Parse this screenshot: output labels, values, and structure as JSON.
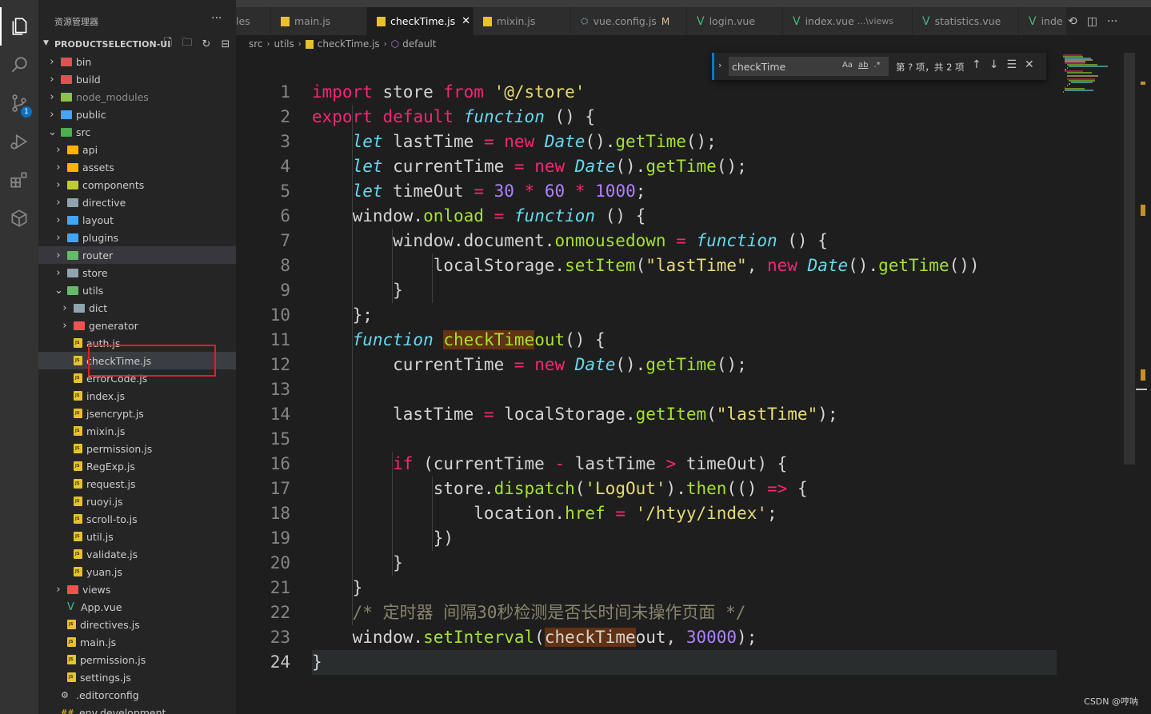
{
  "explorer": {
    "title": "资源管理器",
    "more": "···",
    "project": "PRODUCTSELECTION-UI"
  },
  "tree": [
    {
      "label": "bin",
      "depth": 0,
      "type": "folder",
      "expanded": false,
      "color": "#e05252"
    },
    {
      "label": "build",
      "depth": 0,
      "type": "folder",
      "expanded": false,
      "color": "#e05252"
    },
    {
      "label": "node_modules",
      "depth": 0,
      "type": "folder",
      "expanded": false,
      "color": "#8bc34a",
      "dim": true
    },
    {
      "label": "public",
      "depth": 0,
      "type": "folder",
      "expanded": false,
      "color": "#42a5f5"
    },
    {
      "label": "src",
      "depth": 0,
      "type": "folder",
      "expanded": true,
      "color": "#4caf50"
    },
    {
      "label": "api",
      "depth": 1,
      "type": "folder",
      "expanded": false,
      "color": "#ffb300"
    },
    {
      "label": "assets",
      "depth": 1,
      "type": "folder",
      "expanded": false,
      "color": "#ffb300"
    },
    {
      "label": "components",
      "depth": 1,
      "type": "folder",
      "expanded": false,
      "color": "#c0ca33"
    },
    {
      "label": "directive",
      "depth": 1,
      "type": "folder",
      "expanded": false,
      "color": "#90a4ae"
    },
    {
      "label": "layout",
      "depth": 1,
      "type": "folder",
      "expanded": false,
      "color": "#42a5f5"
    },
    {
      "label": "plugins",
      "depth": 1,
      "type": "folder",
      "expanded": false,
      "color": "#42a5f5"
    },
    {
      "label": "router",
      "depth": 1,
      "type": "folder",
      "expanded": false,
      "color": "#66bb6a",
      "hl": true
    },
    {
      "label": "store",
      "depth": 1,
      "type": "folder",
      "expanded": false,
      "color": "#90a4ae"
    },
    {
      "label": "utils",
      "depth": 1,
      "type": "folder",
      "expanded": true,
      "color": "#66bb6a"
    },
    {
      "label": "dict",
      "depth": 2,
      "type": "folder",
      "expanded": false,
      "color": "#90a4ae"
    },
    {
      "label": "generator",
      "depth": 2,
      "type": "folder",
      "expanded": false,
      "color": "#ef5350"
    },
    {
      "label": "auth.js",
      "depth": 2,
      "type": "js"
    },
    {
      "label": "checkTime.js",
      "depth": 2,
      "type": "js",
      "selected": true
    },
    {
      "label": "errorCode.js",
      "depth": 2,
      "type": "js"
    },
    {
      "label": "index.js",
      "depth": 2,
      "type": "js"
    },
    {
      "label": "jsencrypt.js",
      "depth": 2,
      "type": "js"
    },
    {
      "label": "mixin.js",
      "depth": 2,
      "type": "js"
    },
    {
      "label": "permission.js",
      "depth": 2,
      "type": "js"
    },
    {
      "label": "RegExp.js",
      "depth": 2,
      "type": "js"
    },
    {
      "label": "request.js",
      "depth": 2,
      "type": "js"
    },
    {
      "label": "ruoyi.js",
      "depth": 2,
      "type": "js"
    },
    {
      "label": "scroll-to.js",
      "depth": 2,
      "type": "js"
    },
    {
      "label": "util.js",
      "depth": 2,
      "type": "js"
    },
    {
      "label": "validate.js",
      "depth": 2,
      "type": "js"
    },
    {
      "label": "yuan.js",
      "depth": 2,
      "type": "js"
    },
    {
      "label": "views",
      "depth": 1,
      "type": "folder",
      "expanded": false,
      "color": "#ef5350"
    },
    {
      "label": "App.vue",
      "depth": 1,
      "type": "vue"
    },
    {
      "label": "directives.js",
      "depth": 1,
      "type": "js"
    },
    {
      "label": "main.js",
      "depth": 1,
      "type": "js"
    },
    {
      "label": "permission.js",
      "depth": 1,
      "type": "js"
    },
    {
      "label": "settings.js",
      "depth": 1,
      "type": "js"
    },
    {
      "label": ".editorconfig",
      "depth": 0,
      "type": "gear"
    },
    {
      "label": ".env.development",
      "depth": 0,
      "type": "env"
    }
  ],
  "tabs": [
    {
      "label": "les",
      "icon": "none",
      "w": 44
    },
    {
      "label": "main.js",
      "icon": "js",
      "w": 120
    },
    {
      "label": "checkTime.js",
      "icon": "js",
      "w": 133,
      "active": true,
      "close": "✕"
    },
    {
      "label": "mixin.js",
      "icon": "js",
      "w": 122
    },
    {
      "label": "vue.config.js",
      "icon": "cfg",
      "w": 145,
      "mod": "M"
    },
    {
      "label": "login.vue",
      "icon": "vue",
      "w": 120
    },
    {
      "label": "index.vue",
      "icon": "vue",
      "w": 162,
      "hint": "...\\views"
    },
    {
      "label": "statistics.vue",
      "icon": "vue",
      "w": 133
    },
    {
      "label": "inde",
      "icon": "vue",
      "w": 60
    }
  ],
  "breadcrumb": [
    "src",
    "utils",
    "checkTime.js",
    "default"
  ],
  "find": {
    "value": "checkTime",
    "opt_case": "Aa",
    "opt_word": "ab",
    "opt_regex": ".*",
    "count": "第 ? 项，共 2 项"
  },
  "activity_badge": "1",
  "watermark": "CSDN @哼呐",
  "colors": {
    "accent": "#007acc",
    "keyword": "#f92672",
    "function": "#a6e22e",
    "string": "#e6db74",
    "number": "#ae81ff",
    "storage": "#66d9ef"
  },
  "code_lines": [
    "import store from '@/store'",
    "export default function () {",
    "    let lastTime = new Date().getTime();",
    "    let currentTime = new Date().getTime();",
    "    let timeOut = 30 * 60 * 1000;",
    "    window.onload = function () {",
    "        window.document.onmousedown = function () {",
    "            localStorage.setItem(\"lastTime\", new Date().getTime())",
    "        }",
    "    };",
    "    function checkTimeout() {",
    "        currentTime = new Date().getTime();",
    "",
    "        lastTime = localStorage.getItem(\"lastTime\");",
    "",
    "        if (currentTime - lastTime > timeOut) {",
    "            store.dispatch('LogOut').then(() => {",
    "                location.href = '/htyy/index';",
    "            })",
    "        }",
    "    }",
    "    /* 定时器 间隔30秒检测是否长时间未操作页面 */",
    "    window.setInterval(checkTimeout, 30000);",
    "}"
  ],
  "current_line": 24
}
